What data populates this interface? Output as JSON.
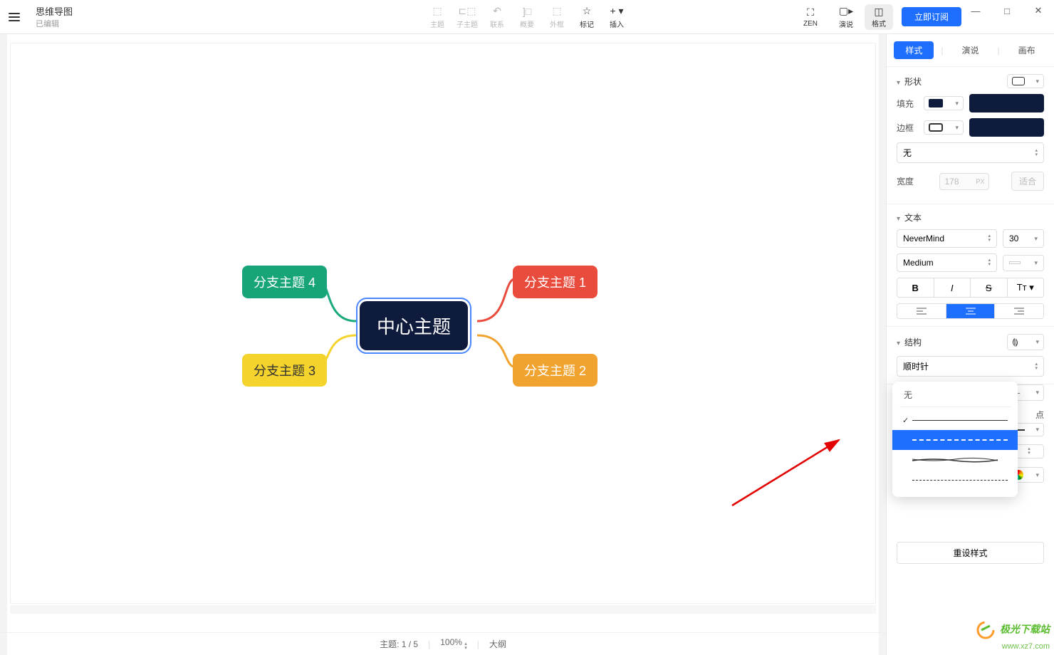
{
  "title": {
    "main": "思维导图",
    "sub": "已编辑"
  },
  "toolbar": {
    "center": [
      {
        "label": "主题",
        "icon": "⬚"
      },
      {
        "label": "子主题",
        "icon": "⊏⬚"
      },
      {
        "label": "联系",
        "icon": "↶"
      },
      {
        "label": "概要",
        "icon": "]□"
      },
      {
        "label": "外框",
        "icon": "⬚"
      },
      {
        "label": "标记",
        "icon": "☆",
        "dark": true
      },
      {
        "label": "插入",
        "icon": "+ ▾",
        "dark": true
      }
    ],
    "right": [
      {
        "label": "ZEN",
        "icon": "⛶"
      },
      {
        "label": "演说",
        "icon": "▢▸"
      }
    ],
    "format": {
      "label": "格式",
      "icon": "◫"
    },
    "subscribe": "立即订阅"
  },
  "window": {
    "min": "—",
    "max": "□",
    "close": "✕"
  },
  "mindmap": {
    "center": "中心主题",
    "branch1": "分支主题 1",
    "branch2": "分支主题 2",
    "branch3": "分支主题 3",
    "branch4": "分支主题 4"
  },
  "panel": {
    "tabs": {
      "style": "样式",
      "present": "演说",
      "canvas": "画布"
    },
    "shape": {
      "label": "形状"
    },
    "fill": {
      "label": "填充"
    },
    "border": {
      "label": "边框",
      "none": "无"
    },
    "width": {
      "label": "宽度",
      "value": "178",
      "unit": "PX",
      "fit": "适合"
    },
    "text": {
      "label": "文本",
      "font": "NeverMind",
      "size": "30",
      "weight": "Medium"
    },
    "formatBtns": {
      "bold": "B",
      "italic": "I",
      "strike": "S",
      "case": "Tт ▾"
    },
    "align": {
      "left": "≡",
      "center": "≡",
      "right": "≡"
    },
    "structure": {
      "label": "结构",
      "direction": "顺时针"
    },
    "connector": {
      "endpoint_partial": "点"
    },
    "lineStyle": {
      "label": "无"
    },
    "reset": "重设样式"
  },
  "status": {
    "topics": "主题: 1 / 5",
    "zoom": "100%",
    "outline": "大纲"
  },
  "watermark": {
    "line1": "极光下载站",
    "line2": "www.xz7.com"
  }
}
